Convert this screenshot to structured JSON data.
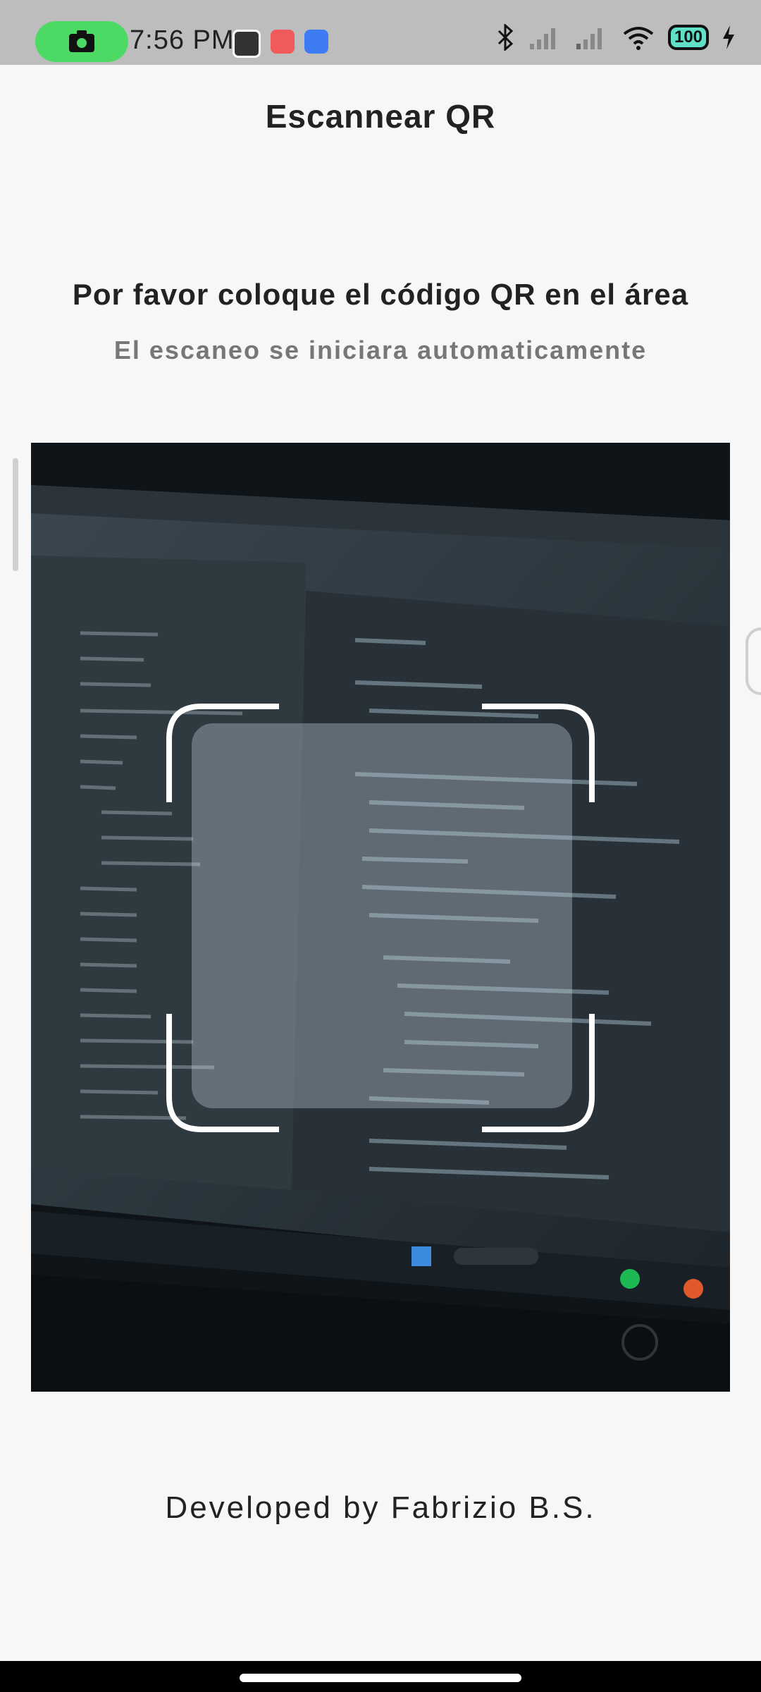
{
  "status_bar": {
    "time": "7:56 PM",
    "battery": "100",
    "colors": {
      "background": "#bdbdbd",
      "record_pill": "#4cd964",
      "battery_fill": "#5fe0c7"
    },
    "icons": [
      "camera-icon",
      "bluetooth-icon",
      "signal-icon",
      "wifi-icon",
      "battery-icon",
      "charging-icon"
    ]
  },
  "header": {
    "title": "Escannear QR"
  },
  "instructions": {
    "title": "Por favor coloque el código QR en el área",
    "subtitle": "El escaneo se iniciara automaticamente"
  },
  "footer": {
    "text": "Developed by Fabrizio B.S."
  }
}
